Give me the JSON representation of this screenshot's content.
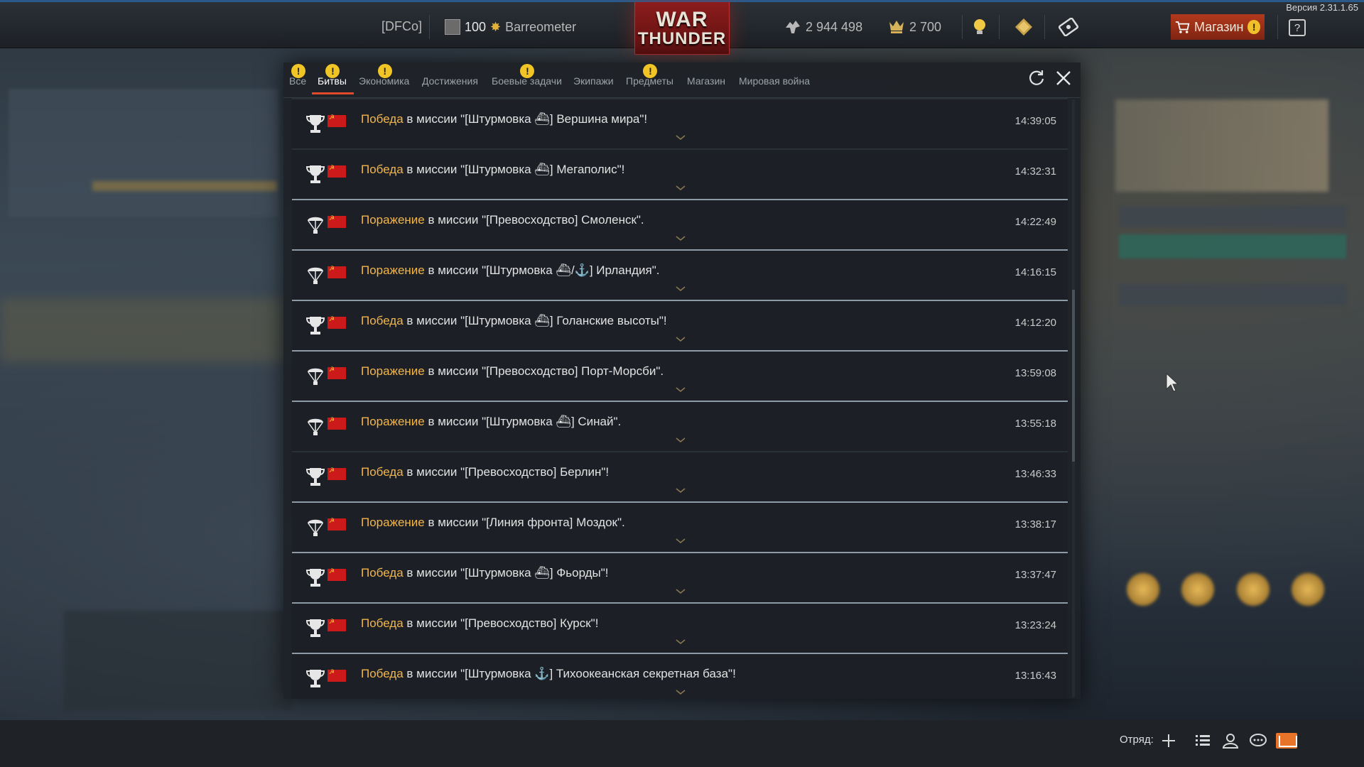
{
  "version": "Версия 2.31.1.65",
  "topbar": {
    "clan": "[DFCo]",
    "rank": "100",
    "player": "Barreometer",
    "silver": "2 944 498",
    "gold": "2 700",
    "shop_label": "Магазин",
    "help": "?"
  },
  "logo": {
    "line1": "WAR",
    "line2": "THUNDER"
  },
  "tabs": [
    {
      "label": "Все",
      "warn": true
    },
    {
      "label": "Битвы",
      "warn": true,
      "active": true
    },
    {
      "label": "Экономика",
      "warn": true
    },
    {
      "label": "Достижения",
      "warn": false
    },
    {
      "label": "Боевые задачи",
      "warn": true
    },
    {
      "label": "Экипажи",
      "warn": false
    },
    {
      "label": "Предметы",
      "warn": true
    },
    {
      "label": "Магазин",
      "warn": false
    },
    {
      "label": "Мировая война",
      "warn": false
    }
  ],
  "entries": [
    {
      "result": "Победа",
      "text": " в миссии \"[Штурмовка ⛴] Вершина мира\"!",
      "time": "14:39:05",
      "win": true
    },
    {
      "result": "Победа",
      "text": " в миссии \"[Штурмовка ⛴] Мегаполис\"!",
      "time": "14:32:31",
      "win": true
    },
    {
      "result": "Поражение",
      "text": " в миссии \"[Превосходство] Смоленск\".",
      "time": "14:22:49",
      "win": false
    },
    {
      "result": "Поражение",
      "text": " в миссии \"[Штурмовка ⛴/⚓] Ирландия\".",
      "time": "14:16:15",
      "win": false
    },
    {
      "result": "Победа",
      "text": " в миссии \"[Штурмовка ⛴] Голанские высоты\"!",
      "time": "14:12:20",
      "win": true
    },
    {
      "result": "Поражение",
      "text": " в миссии \"[Превосходство] Порт-Морсби\".",
      "time": "13:59:08",
      "win": false
    },
    {
      "result": "Поражение",
      "text": " в миссии \"[Штурмовка ⛴] Синай\".",
      "time": "13:55:18",
      "win": false
    },
    {
      "result": "Победа",
      "text": " в миссии \"[Превосходство] Берлин\"!",
      "time": "13:46:33",
      "win": true
    },
    {
      "result": "Поражение",
      "text": " в миссии \"[Линия фронта] Моздок\".",
      "time": "13:38:17",
      "win": false
    },
    {
      "result": "Победа",
      "text": " в миссии \"[Штурмовка ⛴] Фьорды\"!",
      "time": "13:37:47",
      "win": true
    },
    {
      "result": "Победа",
      "text": " в миссии \"[Превосходство] Курск\"!",
      "time": "13:23:24",
      "win": true
    },
    {
      "result": "Победа",
      "text": " в миссии \"[Штурмовка ⚓] Тихоокеанская секретная база\"!",
      "time": "13:16:43",
      "win": true
    }
  ],
  "bottombar": {
    "squad_label": "Отряд:"
  },
  "colors": {
    "accent": "#e04a2a",
    "result": "#f2b54a",
    "warn": "#f2c526",
    "shop": "#b3391c"
  }
}
